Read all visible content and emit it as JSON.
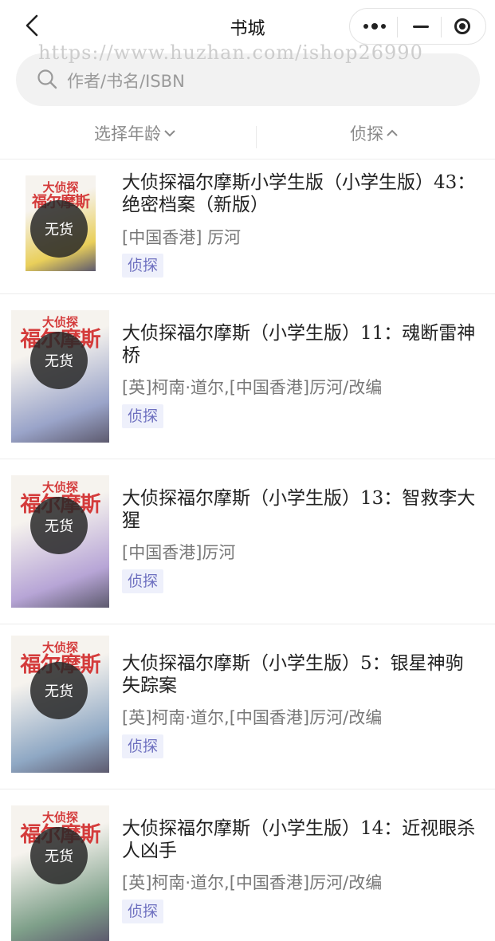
{
  "nav": {
    "title": "书城"
  },
  "watermark": "https://www.huzhan.com/ishop26990",
  "search": {
    "placeholder": "作者/书名/ISBN"
  },
  "filters": {
    "age_label": "选择年龄",
    "category_label": "侦探"
  },
  "books": [
    {
      "title": "大侦探福尔摩斯小学生版（小学生版）43：绝密档案（新版）",
      "author": "[中国香港] 厉河",
      "tag": "侦探",
      "status": "无货",
      "cover_text_1": "大侦探",
      "cover_text_2": "福尔摩斯",
      "cover_color": "#e9cf5a"
    },
    {
      "title": "大侦探福尔摩斯（小学生版）11：魂断雷神桥",
      "author": "[英]柯南·道尔,[中国香港]厉河/改编",
      "tag": "侦探",
      "status": "无货",
      "cover_text_1": "大侦探",
      "cover_text_2": "福尔摩斯",
      "cover_color": "#9aa4c9"
    },
    {
      "title": "大侦探福尔摩斯（小学生版）13：智救李大猩",
      "author": "[中国香港]厉河",
      "tag": "侦探",
      "status": "无货",
      "cover_text_1": "大侦探",
      "cover_text_2": "福尔摩斯",
      "cover_color": "#b7a5d6"
    },
    {
      "title": "大侦探福尔摩斯（小学生版）5：银星神驹失踪案",
      "author": "[英]柯南·道尔,[中国香港]厉河/改编",
      "tag": "侦探",
      "status": "无货",
      "cover_text_1": "大侦探",
      "cover_text_2": "福尔摩斯",
      "cover_color": "#8fa8c4"
    },
    {
      "title": "大侦探福尔摩斯（小学生版）14：近视眼杀人凶手",
      "author": "[英]柯南·道尔,[中国香港]厉河/改编",
      "tag": "侦探",
      "status": "无货",
      "cover_text_1": "大侦探",
      "cover_text_2": "福尔摩斯",
      "cover_color": "#7fa08a"
    }
  ]
}
